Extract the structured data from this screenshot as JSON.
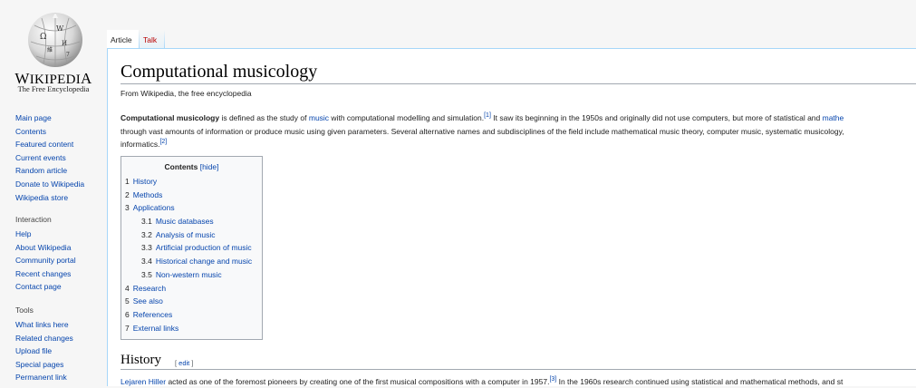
{
  "logo": {
    "wordmark_first": "W",
    "wordmark_rest_1": "IKIPEDI",
    "wordmark_last": "A",
    "tagline": "The Free Encyclopedia"
  },
  "nav": {
    "main_items": [
      "Main page",
      "Contents",
      "Featured content",
      "Current events",
      "Random article",
      "Donate to Wikipedia",
      "Wikipedia store"
    ],
    "interaction_heading": "Interaction",
    "interaction_items": [
      "Help",
      "About Wikipedia",
      "Community portal",
      "Recent changes",
      "Contact page"
    ],
    "tools_heading": "Tools",
    "tools_items": [
      "What links here",
      "Related changes",
      "Upload file",
      "Special pages",
      "Permanent link"
    ]
  },
  "tabs": {
    "article": "Article",
    "talk": "Talk"
  },
  "article": {
    "title": "Computational musicology",
    "tagline": "From Wikipedia, the free encyclopedia",
    "intro": {
      "bold_term": "Computational musicology",
      "t1": " is defined as the study of ",
      "link_music": "music",
      "t2": " with computational modelling and simulation.",
      "ref1": "[1]",
      "t3": " It saw its beginning in the 1950s and originally did not use computers, but more of statistical and ",
      "link_math": "mathe",
      "line2": "through vast amounts of information or produce music using given parameters. Several alternative names and subdisciplines of the field include mathematical music theory, computer music, systematic musicology,",
      "line3": "informatics.",
      "ref2": "[2]"
    },
    "toc": {
      "title": "Contents",
      "hide": "[hide]",
      "items": [
        {
          "num": "1",
          "text": "History"
        },
        {
          "num": "2",
          "text": "Methods"
        },
        {
          "num": "3",
          "text": "Applications"
        },
        {
          "num": "3.1",
          "text": "Music databases"
        },
        {
          "num": "3.2",
          "text": "Analysis of music"
        },
        {
          "num": "3.3",
          "text": "Artificial production of music"
        },
        {
          "num": "3.4",
          "text": "Historical change and music"
        },
        {
          "num": "3.5",
          "text": "Non-western music"
        },
        {
          "num": "4",
          "text": "Research"
        },
        {
          "num": "5",
          "text": "See also"
        },
        {
          "num": "6",
          "text": "References"
        },
        {
          "num": "7",
          "text": "External links"
        }
      ]
    },
    "history": {
      "heading": "History",
      "edit_open": "[ ",
      "edit_link": "edit",
      "edit_close": " ]",
      "link_hiller": "Lejaren Hiller",
      "t1": " acted as one of the foremost pioneers by creating one of the first musical compositions with a computer in 1957.",
      "ref3": "[3]",
      "t2": " In the 1960s research continued using statistical and mathematical methods, and st"
    }
  }
}
